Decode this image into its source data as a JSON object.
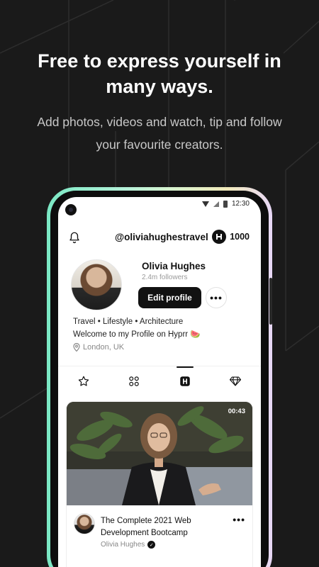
{
  "promo": {
    "title": "Free to express yourself in many ways.",
    "subtitle": "Add photos, videos and watch, tip and follow your favourite creators."
  },
  "status_bar": {
    "time": "12:30",
    "icons": [
      "wifi-icon",
      "signal-icon",
      "battery-icon"
    ]
  },
  "header": {
    "notification_icon": "bell-icon",
    "handle": "@oliviahughestravel",
    "coin_icon": "hyprr-coin-icon",
    "coin_count": "1000"
  },
  "profile": {
    "name": "Olivia Hughes",
    "followers": "2.4m followers",
    "edit_label": "Edit profile",
    "more_label": "•••",
    "bio_tags": "Travel • Lifestyle • Architecture",
    "bio": "Welcome to my Profile on  Hyprr 🍉",
    "location": "London, UK"
  },
  "tabs": [
    {
      "icon": "star-icon",
      "active": false
    },
    {
      "icon": "grid-icon",
      "active": false
    },
    {
      "icon": "hyprr-icon",
      "active": true
    },
    {
      "icon": "diamond-icon",
      "active": false
    }
  ],
  "card": {
    "duration": "00:43",
    "title": "The Complete 2021 Web Development Bootcamp",
    "author": "Olivia Hughes",
    "more_label": "•••"
  },
  "colors": {
    "background": "#1a1a1a",
    "accent_gradient_start": "#7ae8c4",
    "accent_gradient_end": "#e8d8f7",
    "button": "#111111"
  }
}
